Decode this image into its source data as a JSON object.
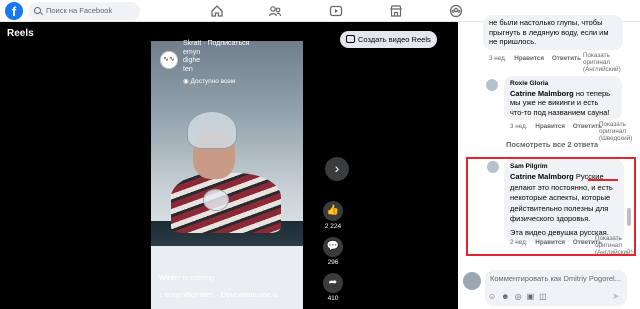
{
  "header": {
    "logo": "f",
    "search_placeholder": "Поиск на Facebook",
    "nav_icons": [
      "home-icon",
      "friends-icon",
      "watch-icon",
      "marketplace-icon",
      "groups-icon"
    ]
  },
  "reels": {
    "title": "Reels",
    "create_label": "Создать видео Reels",
    "video": {
      "author_line1": "Skratt · Подписаться",
      "author_line2": "emyn",
      "author_line3": "dighe",
      "author_line4": "ten",
      "visibility": "Доступно всем",
      "caption": "Winter is coming",
      "audio": "ennyndigheten · Оригинальное а"
    },
    "actions": {
      "likes": "2 224",
      "comments": "296",
      "shares": "410"
    }
  },
  "comments": {
    "c1_text_l1": "не были настолько глупы, чтобы",
    "c1_text_l2": "прыгнуть в ледяную воду, если им",
    "c1_text_l3": "не пришлось.",
    "c1_meta": {
      "time": "3 нед.",
      "like": "Нравится",
      "reply": "Ответить",
      "translate": "Показать оригинал (Английский)"
    },
    "c2_author": "Roxie Gloria",
    "c2_mention": "Catrine Malmborg",
    "c2_text_l1": "но теперь",
    "c2_text_l2": "мы уже не викинги и есть",
    "c2_text_l3": "что-то под названием сауна!",
    "c2_meta": {
      "time": "3 нед.",
      "like": "Нравится",
      "reply": "Ответить",
      "translate": "Показать оригинал (Шведский)"
    },
    "view_replies": "Посмотреть все 2 ответа",
    "c3_author": "Sam Pilgrim",
    "c3_mention": "Catrine Malmborg",
    "c3_text_l1": "Русские",
    "c3_text_l2": "делают это постоянно, и есть",
    "c3_text_l3": "некоторые аспекты, которые",
    "c3_text_l4": "действительно полезны для",
    "c3_text_l5": "физического здоровья.",
    "c3_text_l6": "Эта видео девушка русская.",
    "c3_meta": {
      "time": "2 нед.",
      "like": "Нравится",
      "reply": "Ответить",
      "translate": "Показать оригинал (Английский)"
    },
    "composer_placeholder": "Комментировать как Dmitriy Pogorel..."
  },
  "colors": {
    "brand": "#1877f2",
    "highlight": "#e3252f"
  }
}
